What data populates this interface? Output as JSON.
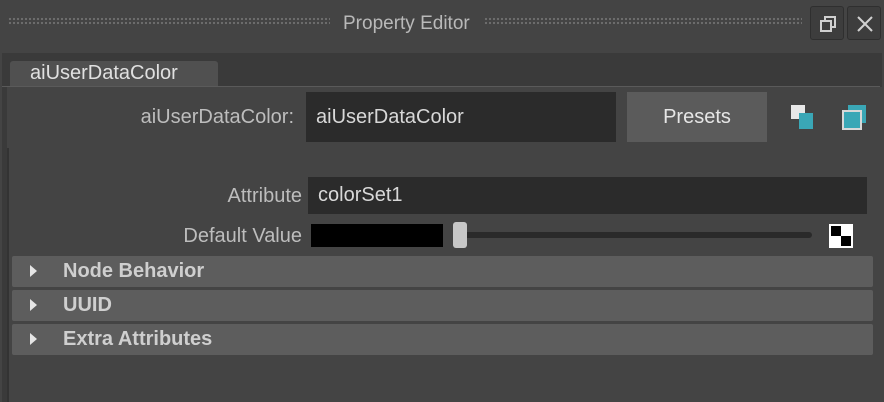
{
  "window": {
    "title": "Property Editor",
    "float_icon": "restore-window-icon",
    "close_icon": "close-icon"
  },
  "tabs": [
    {
      "label": "aiUserDataColor",
      "active": true
    }
  ],
  "node": {
    "name_label": "aiUserDataColor:",
    "name_value": "aiUserDataColor",
    "presets_label": "Presets",
    "show_input_icon": "input-output-icon",
    "copy_tab_icon": "copy-tab-icon"
  },
  "attributes": {
    "attribute_label": "Attribute",
    "attribute_value": "colorSet1",
    "default_value_label": "Default Value",
    "default_color": "#000000",
    "default_value_slider": 0.0,
    "map_icon": "checker-map-icon"
  },
  "sections": [
    {
      "title": "Node Behavior",
      "collapsed": true
    },
    {
      "title": "UUID",
      "collapsed": true
    },
    {
      "title": "Extra Attributes",
      "collapsed": true
    }
  ],
  "colors": {
    "accent_cyan": "#3aa7b6",
    "background": "#444444"
  }
}
